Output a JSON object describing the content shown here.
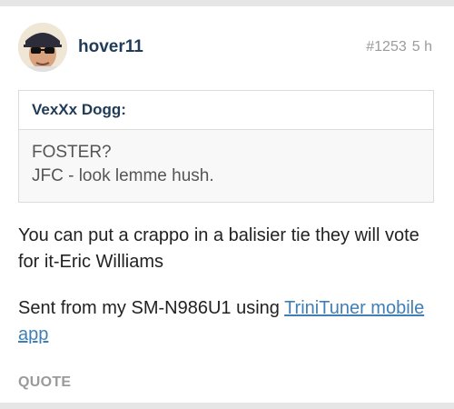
{
  "post": {
    "username": "hover11",
    "post_number": "#1253",
    "time_ago": "5 h",
    "quote": {
      "author": "VexXx Dogg:",
      "lines": [
        "FOSTER?",
        "JFC - look lemme hush."
      ]
    },
    "message": "You can put a crappo in a balisier tie they will vote for it-Eric Williams",
    "signature": {
      "prefix": "Sent from my SM-N986U1 using ",
      "link_text": "TriniTuner mobile app"
    },
    "actions": {
      "quote_label": "QUOTE"
    }
  },
  "icons": {
    "avatar": "user-avatar-photo"
  },
  "colors": {
    "username": "#1f3b57",
    "link": "#3f7fb6",
    "meta": "#9b9b9b",
    "band": "#e6e6e6"
  }
}
